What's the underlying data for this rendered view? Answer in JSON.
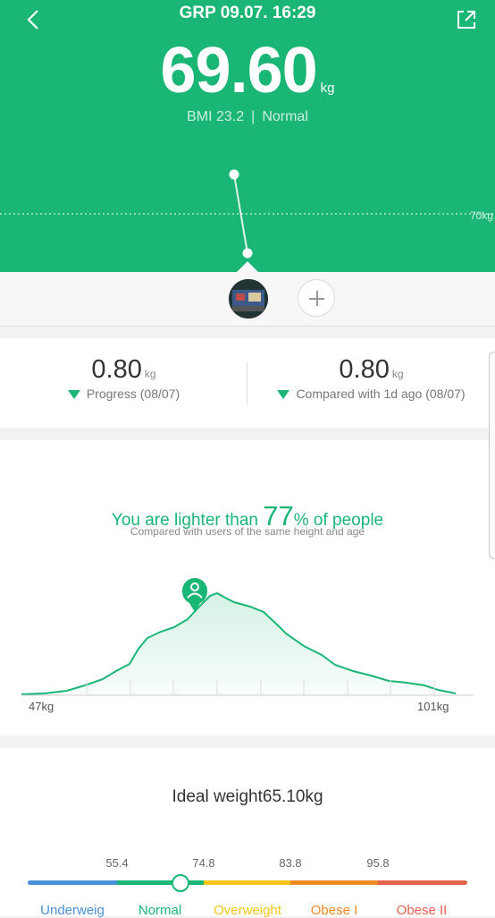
{
  "header": {
    "title": "GRP 09.07. 16:29",
    "weight": "69.60",
    "unit": "kg",
    "bmi": "BMI 23.2",
    "status": "Normal",
    "reference_label": "70kg",
    "back_icon": "chevron-left-icon",
    "share_icon": "share-icon"
  },
  "stats": {
    "progress": {
      "value": "0.80",
      "unit": "kg",
      "label": "Progress (08/07)"
    },
    "compared": {
      "value": "0.80",
      "unit": "kg",
      "label": "Compared with 1d ago (08/07)"
    }
  },
  "ranking": {
    "prefix": "You are lighter than",
    "percent": "77",
    "suffix": "% of people",
    "note": "Compared with users of the same height and age",
    "min_label": "47kg",
    "max_label": "101kg"
  },
  "ideal": {
    "label": "Ideal weight",
    "value": "65.10",
    "unit": "kg",
    "thresholds": [
      "55.4",
      "74.8",
      "83.8",
      "95.8"
    ],
    "categories": [
      {
        "label": "Underweig",
        "color": "#4a90d9"
      },
      {
        "label": "Normal",
        "color": "#1ab675"
      },
      {
        "label": "Overweight",
        "color": "#f5c518"
      },
      {
        "label": "Obese I",
        "color": "#f08a24"
      },
      {
        "label": "Obese II",
        "color": "#e8624e"
      }
    ]
  },
  "colors": {
    "accent": "#1ab675"
  }
}
